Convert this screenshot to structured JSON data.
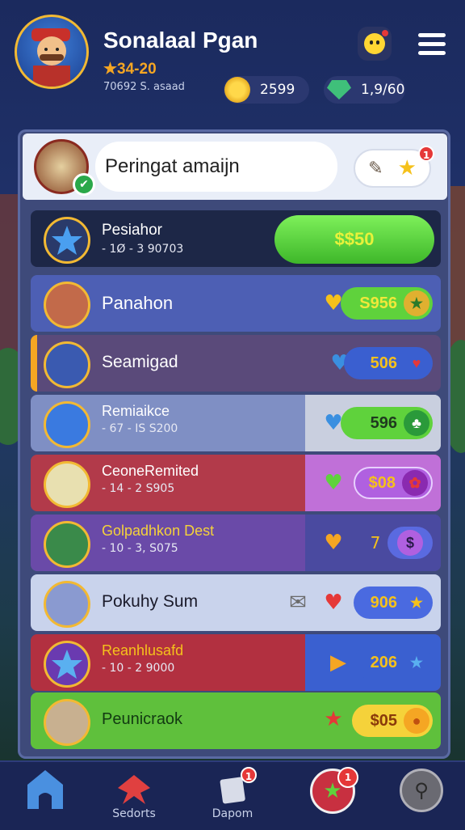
{
  "header": {
    "player_name": "Sonalaal Pgan",
    "star_score": "34-20",
    "sub_line": "70692 S. asaad",
    "coins": "2599",
    "gems": "1,9/60"
  },
  "search": {
    "value": "Peringat amaijn",
    "gift_badge": "1"
  },
  "rows": [
    {
      "title": "Pesiahor",
      "sub": "- 1Ø - 3 90703",
      "button": "$$50"
    },
    {
      "title": "Panahon",
      "sub": "",
      "button": "S956"
    },
    {
      "title": "Seamigad",
      "sub": "",
      "button": "506"
    },
    {
      "title": "Remiaikce",
      "sub": "- 67 - IS S200",
      "button": "596"
    },
    {
      "title": "CeoneRemited",
      "sub": "- 14 - 2 S905",
      "button": "$08"
    },
    {
      "title": "Golpadhkon Dest",
      "sub": "- 10 - 3, S075",
      "button": "7"
    },
    {
      "title": "Pokuhy Sum",
      "sub": "",
      "button": "906"
    },
    {
      "title": "Reanhlusafd",
      "sub": "- 10 - 2 9000",
      "button": "206"
    },
    {
      "title": "Peunicraok",
      "sub": "",
      "button": "$05"
    }
  ],
  "nav": {
    "home": "",
    "secondary": "Sedorts",
    "third": "Dapom",
    "third_badge": "1",
    "fourth_badge": "1"
  },
  "colors": {
    "accent_green": "#5fd23c",
    "gold": "#f2b933",
    "panel": "#3e4a7a"
  }
}
